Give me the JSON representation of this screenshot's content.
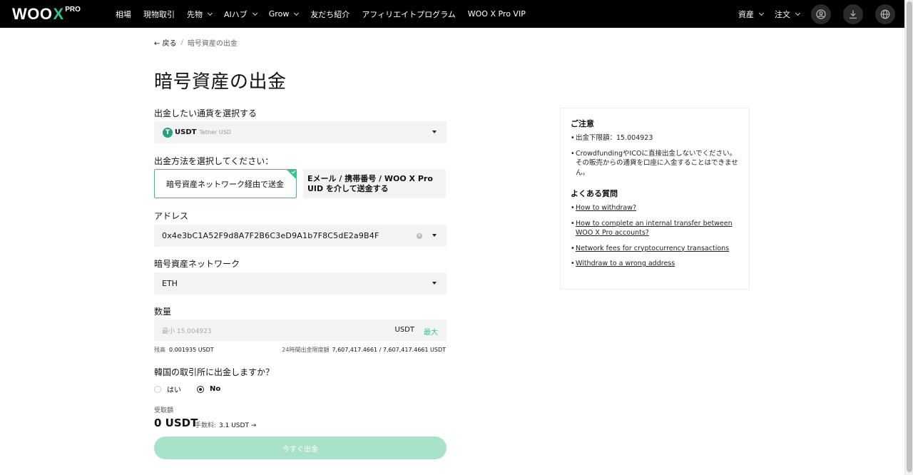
{
  "nav": {
    "logo_main": "WOO",
    "logo_x": "X",
    "logo_pro": "PRO",
    "items": [
      "相場",
      "現物取引",
      "先物",
      "AIハブ",
      "Grow",
      "友だち紹介",
      "アフィリエイトプログラム",
      "WOO X Pro VIP"
    ],
    "right": [
      "資産",
      "注文"
    ]
  },
  "breadcrumb": {
    "back": "← 戻る",
    "sep": "/",
    "current": "暗号資産の出金"
  },
  "title": "暗号資産の出金",
  "currency": {
    "label": "出金したい通貨を選択する",
    "symbol": "USDT",
    "name": "Tether USD",
    "icon": "tether-icon"
  },
  "method": {
    "label": "出金方法を選択してください：",
    "option_a": "暗号資産ネットワーク経由で送金",
    "option_b": "Eメール / 携帯番号 / WOO X Pro UID を介して送金する"
  },
  "address": {
    "label": "アドレス",
    "value": "0x4e3bC1A52F9d8A7F2B6C3eD9A1b7F8C5dE2a9B4F"
  },
  "network": {
    "label": "暗号資産ネットワーク",
    "value": "ETH"
  },
  "amount": {
    "label": "数量",
    "placeholder": "最小 15.004923",
    "unit": "USDT",
    "max": "最大",
    "balance_label": "残高",
    "balance_value": "0.001935 USDT",
    "limit_label": "24時間出金限度額",
    "limit_value": "7,607,417.4661 / 7,607,417.4661 USDT"
  },
  "korea": {
    "question": "韓国の取引所に出金しますか？",
    "yes": "はい",
    "no": "No",
    "selected": "no"
  },
  "receive": {
    "label": "受取額",
    "amount": "0 USDT",
    "fee_label": "手数料:",
    "fee_value": "3.1 USDT →"
  },
  "submit": "今すぐ出金",
  "notice": {
    "title": "ご注意",
    "items": [
      "出金下限額：15.004923",
      "CrowdfundingやICOに直接出金しないでください。その販売からの通貨を口座に入金することはできません。"
    ]
  },
  "faq": {
    "title": "よくある質問",
    "items": [
      "How to withdraw?",
      "How to complete an internal transfer between WOO X Pro accounts?",
      "Network fees for cryptocurrency transactions",
      "Withdraw to a wrong address"
    ]
  },
  "colors": {
    "accent": "#34c38f",
    "submit_disabled": "#a8e2c9",
    "topbar": "#000000",
    "field_bg": "#f2f3f5"
  }
}
